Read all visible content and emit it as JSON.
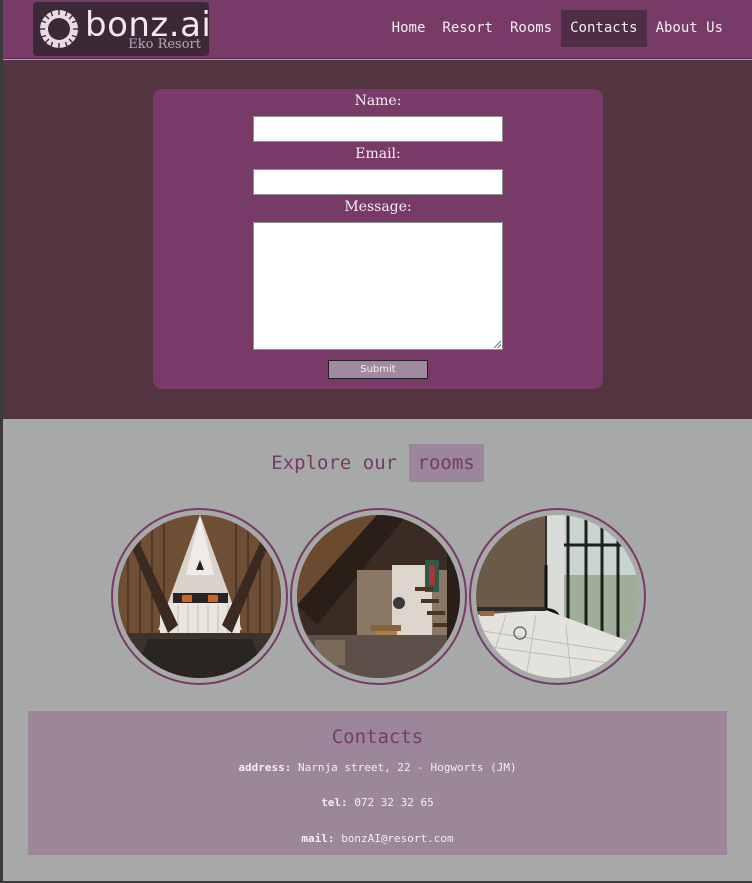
{
  "brand": {
    "name": "bonz.ai",
    "subtitle": "Eko Resort",
    "logo_icon": "sun-gear-icon"
  },
  "nav": {
    "items": [
      {
        "label": "Home",
        "active": false
      },
      {
        "label": "Resort",
        "active": false
      },
      {
        "label": "Rooms",
        "active": false
      },
      {
        "label": "Contacts",
        "active": true
      },
      {
        "label": "About Us",
        "active": false
      }
    ]
  },
  "form": {
    "name_label": "Name:",
    "name_value": "",
    "email_label": "Email:",
    "email_value": "",
    "message_label": "Message:",
    "message_value": "",
    "submit_label": "Submit"
  },
  "rooms": {
    "title_prefix": "Explore our",
    "title_highlight": "rooms",
    "images": [
      "a-frame-bedroom",
      "loft-staircase-room",
      "glass-wall-fireplace-room"
    ]
  },
  "contacts": {
    "title": "Contacts",
    "address_label": "address:",
    "address_value": "Narnja street, 22 - Hogworts (JM)",
    "tel_label": "tel:",
    "tel_value": "072 32 32 65",
    "mail_label": "mail:",
    "mail_value": "bonzAI@resort.com"
  },
  "colors": {
    "header": "#783a67",
    "form_bg": "#533542",
    "page_bg": "#a6a9a8",
    "contacts_bg": "#9b869a",
    "active_nav": "#4e2d45"
  }
}
